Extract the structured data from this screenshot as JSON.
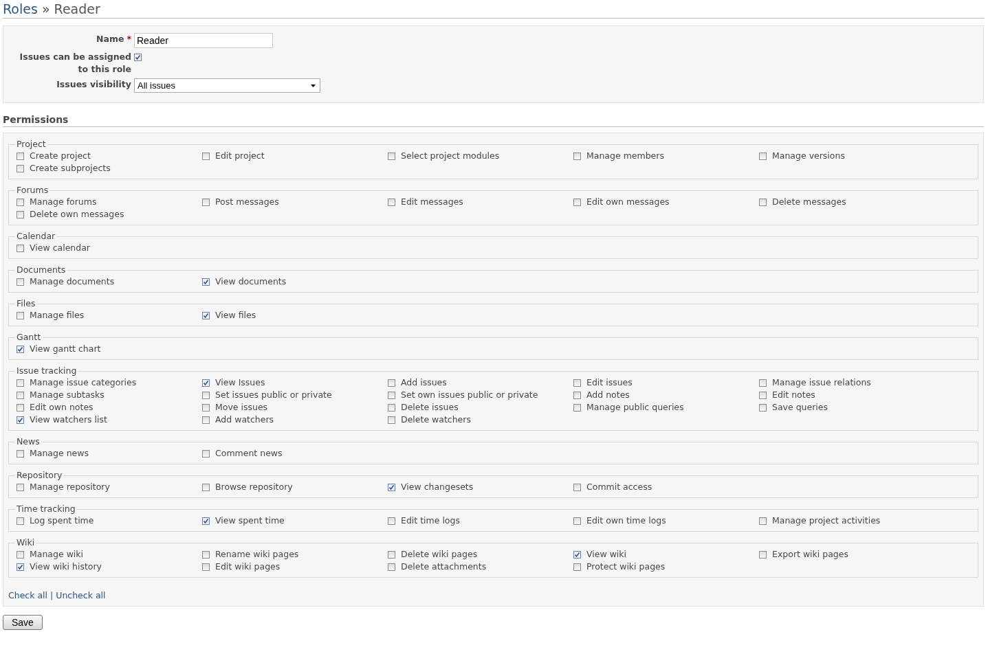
{
  "breadcrumb": {
    "parent": "Roles",
    "separator": "»",
    "current": "Reader"
  },
  "form": {
    "name_label": "Name",
    "required_mark": "*",
    "name_value": "Reader",
    "assignable_label": "Issues can be assigned to this role",
    "assignable_checked": true,
    "visibility_label": "Issues visibility",
    "visibility_value": "All issues"
  },
  "permissions_heading": "Permissions",
  "groups": [
    {
      "title": "Project",
      "items": [
        {
          "label": "Create project",
          "checked": false
        },
        {
          "label": "Edit project",
          "checked": false
        },
        {
          "label": "Select project modules",
          "checked": false
        },
        {
          "label": "Manage members",
          "checked": false
        },
        {
          "label": "Manage versions",
          "checked": false
        },
        {
          "label": "Create subprojects",
          "checked": false
        }
      ]
    },
    {
      "title": "Forums",
      "items": [
        {
          "label": "Manage forums",
          "checked": false
        },
        {
          "label": "Post messages",
          "checked": false
        },
        {
          "label": "Edit messages",
          "checked": false
        },
        {
          "label": "Edit own messages",
          "checked": false
        },
        {
          "label": "Delete messages",
          "checked": false
        },
        {
          "label": "Delete own messages",
          "checked": false
        }
      ]
    },
    {
      "title": "Calendar",
      "items": [
        {
          "label": "View calendar",
          "checked": false
        }
      ]
    },
    {
      "title": "Documents",
      "items": [
        {
          "label": "Manage documents",
          "checked": false
        },
        {
          "label": "View documents",
          "checked": true
        }
      ]
    },
    {
      "title": "Files",
      "items": [
        {
          "label": "Manage files",
          "checked": false
        },
        {
          "label": "View files",
          "checked": true
        }
      ]
    },
    {
      "title": "Gantt",
      "items": [
        {
          "label": "View gantt chart",
          "checked": true
        }
      ]
    },
    {
      "title": "Issue tracking",
      "items": [
        {
          "label": "Manage issue categories",
          "checked": false
        },
        {
          "label": "View Issues",
          "checked": true
        },
        {
          "label": "Add issues",
          "checked": false
        },
        {
          "label": "Edit issues",
          "checked": false
        },
        {
          "label": "Manage issue relations",
          "checked": false
        },
        {
          "label": "Manage subtasks",
          "checked": false
        },
        {
          "label": "Set issues public or private",
          "checked": false
        },
        {
          "label": "Set own issues public or private",
          "checked": false
        },
        {
          "label": "Add notes",
          "checked": false
        },
        {
          "label": "Edit notes",
          "checked": false
        },
        {
          "label": "Edit own notes",
          "checked": false
        },
        {
          "label": "Move issues",
          "checked": false
        },
        {
          "label": "Delete issues",
          "checked": false
        },
        {
          "label": "Manage public queries",
          "checked": false
        },
        {
          "label": "Save queries",
          "checked": false
        },
        {
          "label": "View watchers list",
          "checked": true
        },
        {
          "label": "Add watchers",
          "checked": false
        },
        {
          "label": "Delete watchers",
          "checked": false
        }
      ]
    },
    {
      "title": "News",
      "items": [
        {
          "label": "Manage news",
          "checked": false
        },
        {
          "label": "Comment news",
          "checked": false
        }
      ]
    },
    {
      "title": "Repository",
      "items": [
        {
          "label": "Manage repository",
          "checked": false
        },
        {
          "label": "Browse repository",
          "checked": false
        },
        {
          "label": "View changesets",
          "checked": true
        },
        {
          "label": "Commit access",
          "checked": false
        }
      ]
    },
    {
      "title": "Time tracking",
      "items": [
        {
          "label": "Log spent time",
          "checked": false
        },
        {
          "label": "View spent time",
          "checked": true
        },
        {
          "label": "Edit time logs",
          "checked": false
        },
        {
          "label": "Edit own time logs",
          "checked": false
        },
        {
          "label": "Manage project activities",
          "checked": false
        }
      ]
    },
    {
      "title": "Wiki",
      "items": [
        {
          "label": "Manage wiki",
          "checked": false
        },
        {
          "label": "Rename wiki pages",
          "checked": false
        },
        {
          "label": "Delete wiki pages",
          "checked": false
        },
        {
          "label": "View wiki",
          "checked": true
        },
        {
          "label": "Export wiki pages",
          "checked": false
        },
        {
          "label": "View wiki history",
          "checked": true
        },
        {
          "label": "Edit wiki pages",
          "checked": false
        },
        {
          "label": "Delete attachments",
          "checked": false
        },
        {
          "label": "Protect wiki pages",
          "checked": false
        }
      ]
    }
  ],
  "check_all": "Check all",
  "links_separator": "|",
  "uncheck_all": "Uncheck all",
  "save_button": "Save"
}
